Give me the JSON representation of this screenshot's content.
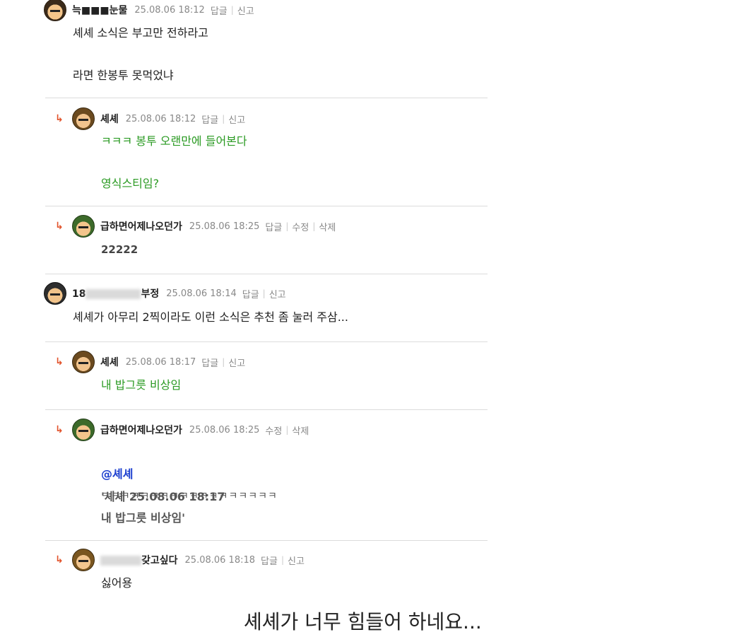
{
  "comments": [
    {
      "nick": "늑■■■눈물",
      "date": "25.08.06 18:12",
      "actions": [
        "답글",
        "신고"
      ],
      "text": "셰셰 소식은 부고만 전하라고\n\n라면 한봉투 못먹었냐"
    },
    {
      "nick": "셰셰",
      "date": "25.08.06 18:12",
      "actions": [
        "답글",
        "신고"
      ],
      "text": "ㅋㅋㅋ 봉투 오랜만에 들어본다\n\n영식스티임?"
    },
    {
      "nick": "급하면어제나오던가",
      "date": "25.08.06 18:25",
      "actions": [
        "답글",
        "수정",
        "삭제"
      ],
      "text": "22222"
    },
    {
      "nick_prefix": "18",
      "nick_suffix": "부정",
      "date": "25.08.06 18:14",
      "actions": [
        "답글",
        "신고"
      ],
      "text": "셰셰가 아무리 2찍이라도 이런 소식은 추천 좀 눌러 주삼..."
    },
    {
      "nick": "셰셰",
      "date": "25.08.06 18:17",
      "actions": [
        "답글",
        "신고"
      ],
      "text": "내 밥그릇 비상임"
    },
    {
      "nick": "급하면어제나오던가",
      "date": "25.08.06 18:25",
      "actions": [
        "수정",
        "삭제"
      ],
      "mention": "@셰셰",
      "text": "ㅋㅋㅋㅋㅋㅋㅋㅋㅋㅋㅋㅋㅋㅋㅋㅋㅋㅋ",
      "quote_line1": "'셰셰 25.08.06 18:17",
      "quote_line2": "내 밥그릇 비상임'"
    },
    {
      "nick_prefix": "갖",
      "nick_suffix": "갖고싶다",
      "date": "25.08.06 18:18",
      "actions": [
        "답글",
        "신고"
      ],
      "text": "싫어용"
    }
  ],
  "reply_arrow": "↳",
  "caption": "셰셰가 너무 힘들어 하네요..."
}
